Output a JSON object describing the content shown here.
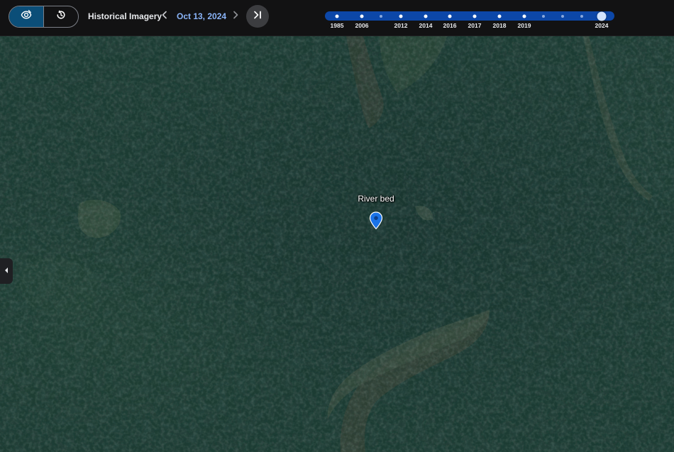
{
  "toolbar": {
    "title": "Historical Imagery",
    "current_date": "Oct 13, 2024",
    "mode_toggle": [
      {
        "name": "imagery-mode",
        "icon": "layers-eye-icon",
        "active": true
      },
      {
        "name": "history-mode",
        "icon": "history-clock-icon",
        "active": false
      }
    ],
    "prev_icon": "chevron-left-icon",
    "next_icon": "chevron-right-icon",
    "latest_icon": "skip-to-latest-icon"
  },
  "timeline": {
    "labeled_years": [
      "1985",
      "2006",
      "2012",
      "2014",
      "2016",
      "2017",
      "2018",
      "2019",
      "2024"
    ],
    "selected_year": "2024",
    "colors": {
      "track": "#0c47a8",
      "thumb": "#d2e3fc"
    }
  },
  "map": {
    "place_label": "River bed",
    "pin_color": "#1a73e8",
    "side_panel_icon": "chevron-left-icon"
  }
}
